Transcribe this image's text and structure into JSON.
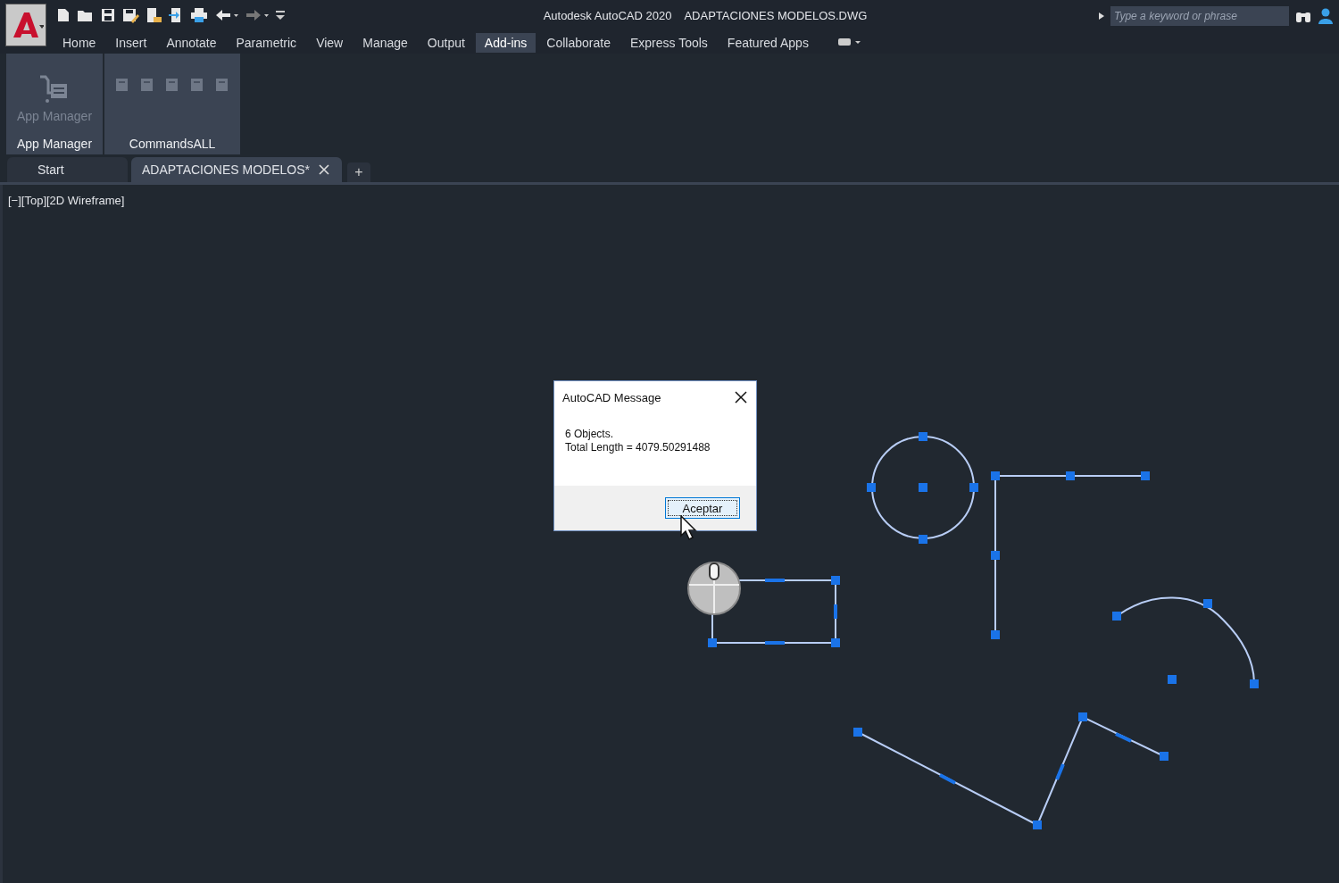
{
  "title_bar": {
    "app_name": "Autodesk AutoCAD 2020",
    "file_name": "ADAPTACIONES MODELOS.DWG"
  },
  "search": {
    "placeholder": "Type a keyword or phrase"
  },
  "ribbon_tabs": [
    {
      "label": "Home",
      "selected": false
    },
    {
      "label": "Insert",
      "selected": false
    },
    {
      "label": "Annotate",
      "selected": false
    },
    {
      "label": "Parametric",
      "selected": false
    },
    {
      "label": "View",
      "selected": false
    },
    {
      "label": "Manage",
      "selected": false
    },
    {
      "label": "Output",
      "selected": false
    },
    {
      "label": "Add-ins",
      "selected": true
    },
    {
      "label": "Collaborate",
      "selected": false
    },
    {
      "label": "Express Tools",
      "selected": false
    },
    {
      "label": "Featured Apps",
      "selected": false
    }
  ],
  "ribbon_panels": [
    {
      "title": "App Manager",
      "kind": "large",
      "button": {
        "label": "App Manager",
        "disabled": true
      }
    },
    {
      "title": "CommandsALL",
      "kind": "small",
      "tools": [
        {
          "disabled": true
        },
        {
          "disabled": true
        },
        {
          "disabled": true
        },
        {
          "disabled": true
        },
        {
          "disabled": true
        }
      ]
    }
  ],
  "doc_tabs": [
    {
      "label": "Start",
      "selected": false,
      "closable": false
    },
    {
      "label": "ADAPTACIONES MODELOS*",
      "selected": true,
      "closable": true
    }
  ],
  "new_tab": "+",
  "viewport_label": "[−][Top][2D Wireframe]",
  "dialog": {
    "title": "AutoCAD Message",
    "lines": [
      "6 Objects.",
      "Total Length = 4079.50291488"
    ],
    "button": "Aceptar"
  }
}
